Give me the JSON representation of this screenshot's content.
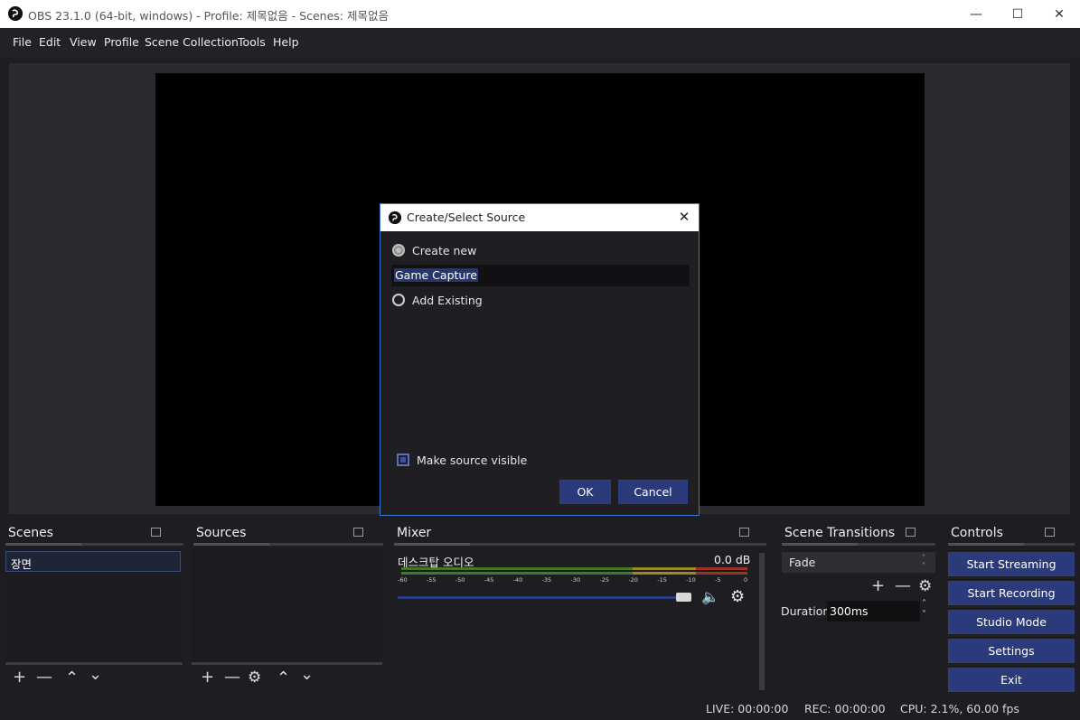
{
  "window": {
    "title": "OBS 23.1.0 (64-bit, windows) - Profile: 제목없음 - Scenes: 제목없음",
    "minimize_icon": "minimize-icon",
    "maximize_icon": "maximize-icon",
    "close_icon": "close-icon"
  },
  "menu": [
    "File",
    "Edit",
    "View",
    "Profile",
    "Scene Collection",
    "Tools",
    "Help"
  ],
  "docks": {
    "scenes": {
      "title": "Scenes",
      "items": [
        "장면"
      ]
    },
    "sources": {
      "title": "Sources"
    },
    "mixer": {
      "title": "Mixer",
      "channel_name": "데스크탑 오디오",
      "level": "0.0 dB",
      "ticks": [
        "-60",
        "-55",
        "-50",
        "-45",
        "-40",
        "-35",
        "-30",
        "-25",
        "-20",
        "-15",
        "-10",
        "-5",
        "0"
      ],
      "volume_fraction": 1.0
    },
    "transitions": {
      "title": "Scene Transitions",
      "selected": "Fade",
      "duration_label": "Duration",
      "duration_value": "300ms"
    },
    "controls": {
      "title": "Controls",
      "buttons": [
        "Start Streaming",
        "Start Recording",
        "Studio Mode",
        "Settings",
        "Exit"
      ]
    }
  },
  "status": {
    "live": "LIVE: 00:00:00",
    "rec": "REC: 00:00:00",
    "cpu": "CPU: 2.1%, 60.00 fps"
  },
  "dialog": {
    "title": "Create/Select Source",
    "create_new_label": "Create new",
    "name_value": "Game Capture",
    "add_existing_label": "Add Existing",
    "visible_label": "Make source visible",
    "ok_label": "OK",
    "cancel_label": "Cancel"
  },
  "colors": {
    "accent_button": "#2a3a7a",
    "dialog_border": "#3a78d6",
    "meter_green": "#4a8a2a",
    "meter_yellow": "#a89428",
    "meter_red": "#a8382a"
  }
}
